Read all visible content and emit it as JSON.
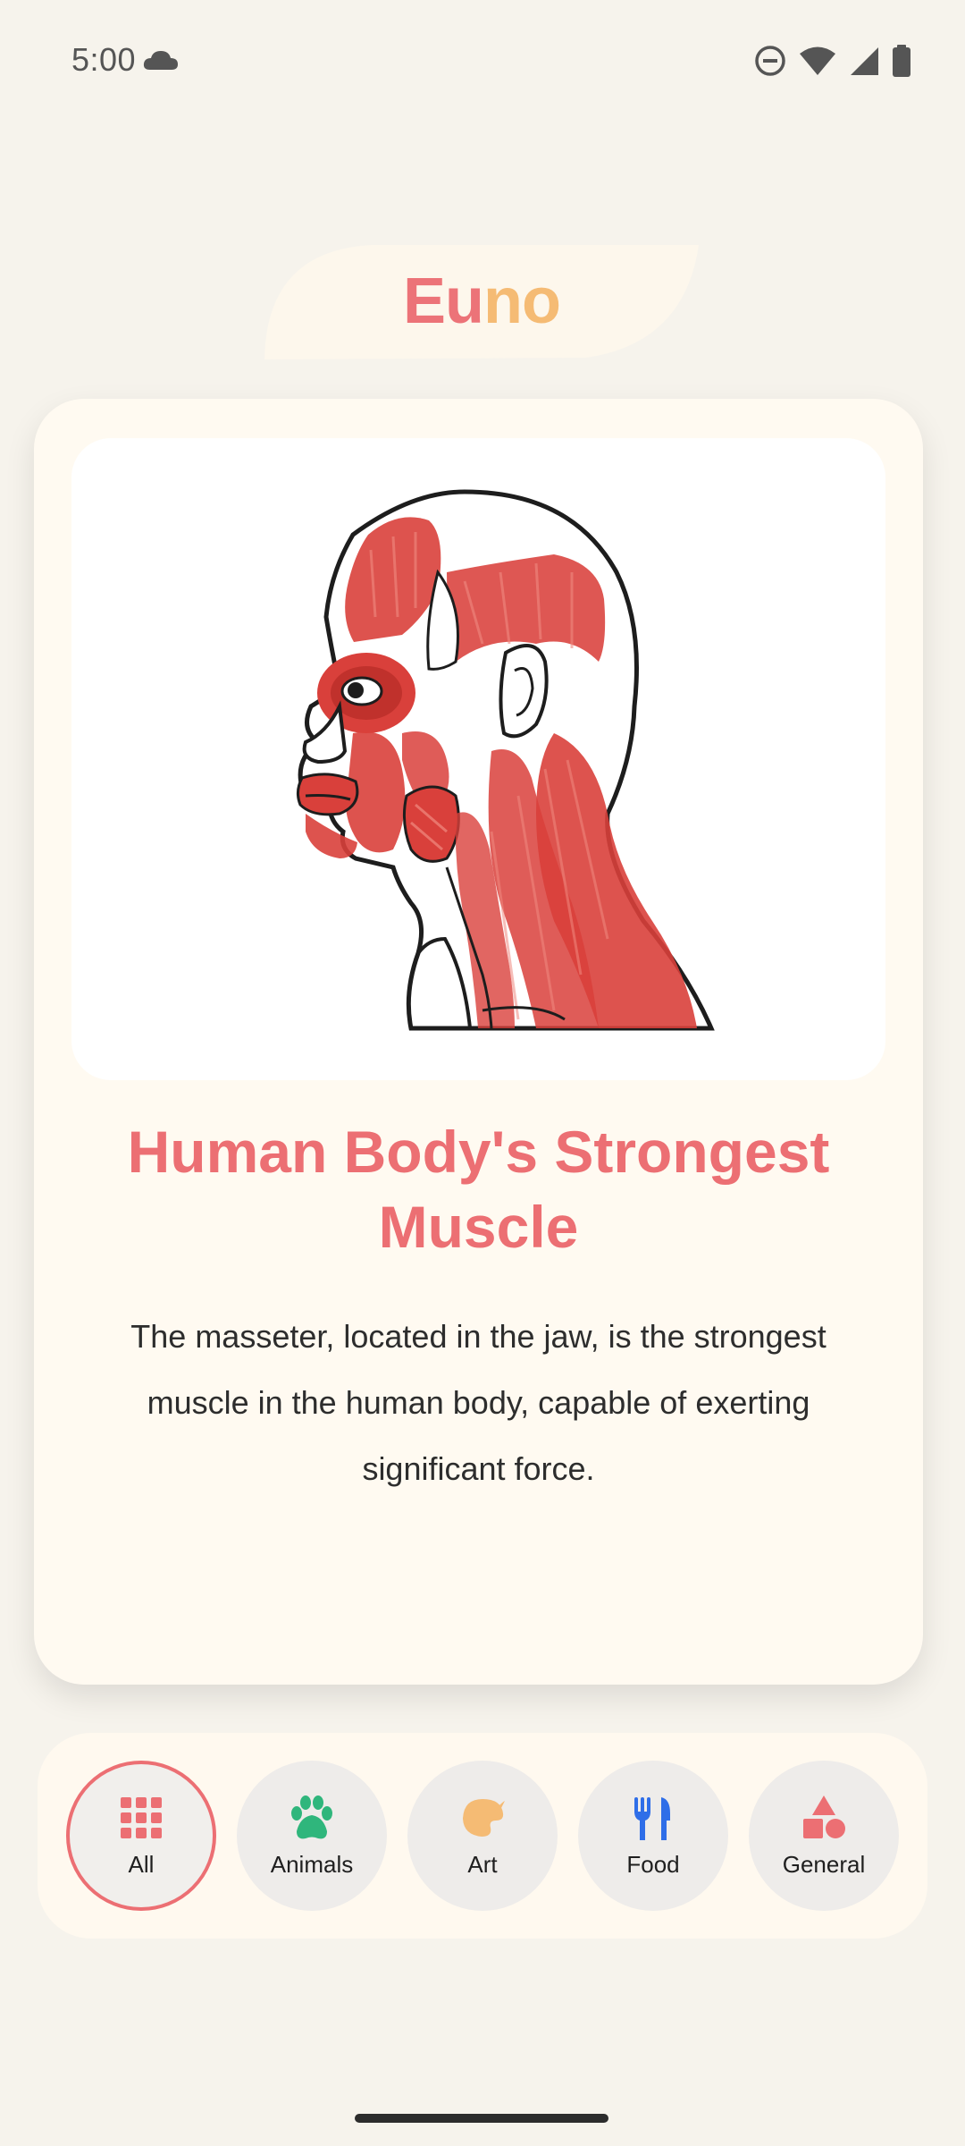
{
  "status_bar": {
    "time": "5:00",
    "icons": [
      "cloud-icon",
      "dnd-icon",
      "wifi-icon",
      "signal-icon",
      "battery-icon"
    ]
  },
  "app": {
    "logo_part1": "Eu",
    "logo_part2": "no",
    "logo_colors": {
      "eu": "#ec7378",
      "no": "#f5bb74"
    }
  },
  "fact": {
    "image": "head-muscles-illustration",
    "title": "Human Body's Strongest Muscle",
    "body": "The masseter, located in the jaw, is the strongest muscle in the human body, capable of exerting significant force."
  },
  "categories": {
    "selected": "All",
    "items": [
      {
        "label": "All",
        "icon": "grid-icon",
        "color": "#ec6f73"
      },
      {
        "label": "Animals",
        "icon": "paw-icon",
        "color": "#2fb67c"
      },
      {
        "label": "Art",
        "icon": "palette-icon",
        "color": "#f5bb74"
      },
      {
        "label": "Food",
        "icon": "utensils-icon",
        "color": "#2f6ee8"
      },
      {
        "label": "General",
        "icon": "shapes-icon",
        "color": "#ec6f73"
      }
    ]
  },
  "theme": {
    "background": "#f6f3ec",
    "card": "#fffaf1",
    "accent": "#ec6f73"
  }
}
